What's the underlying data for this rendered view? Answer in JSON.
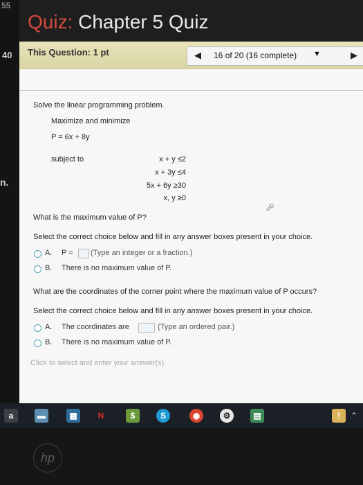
{
  "bezel": {
    "top_number": "55",
    "left_number": "40",
    "left_edge_text": "n."
  },
  "header": {
    "title_prefix": "Quiz:",
    "title_main": "Chapter 5 Quiz"
  },
  "question_bar": {
    "label": "This Question: 1 pt",
    "prev_icon": "left-triangle",
    "next_icon": "right-triangle",
    "selector_text": "16 of 20 (16 complete)",
    "dropdown_icon": "down-triangle"
  },
  "problem": {
    "title": "Solve the linear programming problem.",
    "instruction": "Maximize and minimize",
    "objective": "P = 6x + 8y",
    "subject_to": "subject to",
    "constraints": [
      "x + y  ≤2",
      "x + 3y  ≤4",
      "5x + 6y  ≥30",
      "x, y  ≥0"
    ]
  },
  "part1": {
    "question": "What is the maximum value of P?",
    "instruction": "Select the correct choice below and fill in any answer boxes present in your choice.",
    "option_a_letter": "A.",
    "option_a_text": "P =",
    "option_a_hint": "(Type an integer or a fraction.)",
    "option_b_letter": "B.",
    "option_b_text": "There is no maximum value of P."
  },
  "part2": {
    "question": "What are the coordinates of the corner point where the maximum value of P occurs?",
    "instruction": "Select the correct choice below and fill in any answer boxes present in your choice.",
    "option_a_letter": "A.",
    "option_a_text": "The coordinates are",
    "option_a_hint": "(Type an ordered pair.)",
    "option_b_letter": "B.",
    "option_b_text": "There is no maximum value of P."
  },
  "footer_hint": "Click to select and enter your answer(s).",
  "cursor_icon": "mouse-pointer",
  "taskbar": {
    "left_label": "a",
    "icons": [
      "folder-icon",
      "store-icon",
      "netflix-icon",
      "money-icon",
      "skype-icon",
      "chrome-icon",
      "steam-icon",
      "sheets-icon",
      "notification-icon"
    ],
    "tray_icon": "chevron-up"
  },
  "brand": "hp"
}
